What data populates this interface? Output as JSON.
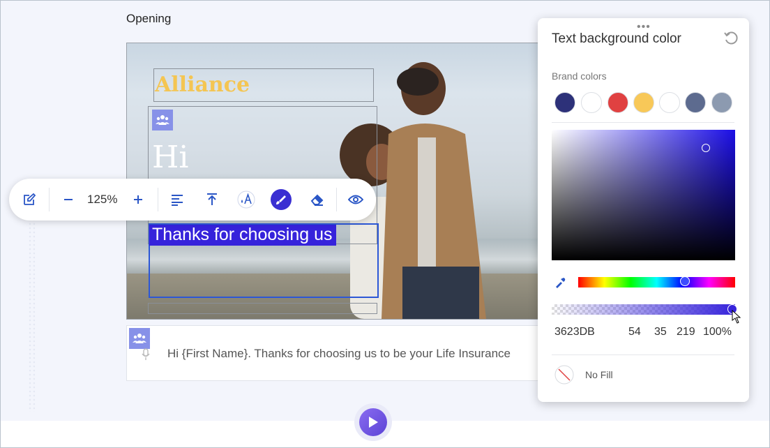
{
  "section": {
    "title": "Opening"
  },
  "canvas": {
    "brand_text": "Alliance",
    "greeting": "Hi",
    "thanks": "Thanks for choosing us"
  },
  "toolbar": {
    "zoom": "125%",
    "items": [
      "edit-icon",
      "zoom-out-icon",
      "zoom-in-icon",
      "align-left-icon",
      "align-top-icon",
      "text-color-icon",
      "background-color-icon",
      "eraser-icon",
      "preview-icon"
    ]
  },
  "script": {
    "text": "Hi {First Name}. Thanks for choosing us to be your Life Insurance"
  },
  "color_panel": {
    "title": "Text background color",
    "brand_label": "Brand colors",
    "brand_colors": [
      "#2d3179",
      "#ffffff",
      "#e04141",
      "#f8c858",
      "#ffffff",
      "#5d6b8f",
      "#8c9ab0"
    ],
    "hex": "3623DB",
    "r": "54",
    "g": "35",
    "b": "219",
    "alpha": "100%",
    "no_fill_label": "No Fill"
  }
}
